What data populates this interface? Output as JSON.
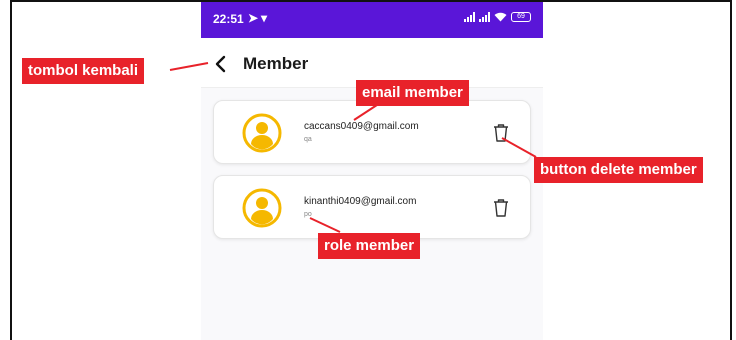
{
  "status_bar": {
    "time": "22:51",
    "battery": "69"
  },
  "app_bar": {
    "title": "Member"
  },
  "members": [
    {
      "email": "caccans0409@gmail.com",
      "role": "qa"
    },
    {
      "email": "kinanthi0409@gmail.com",
      "role": "po"
    }
  ],
  "annotations": {
    "back": "tombol kembali",
    "email": "email member",
    "delete": "button delete member",
    "role": "role member"
  },
  "colors": {
    "status_bar": "#5a16d8",
    "avatar": "#f5b800",
    "annotation": "#e8222a"
  },
  "icons": [
    "back-arrow-icon",
    "user-avatar-icon",
    "trash-icon"
  ]
}
